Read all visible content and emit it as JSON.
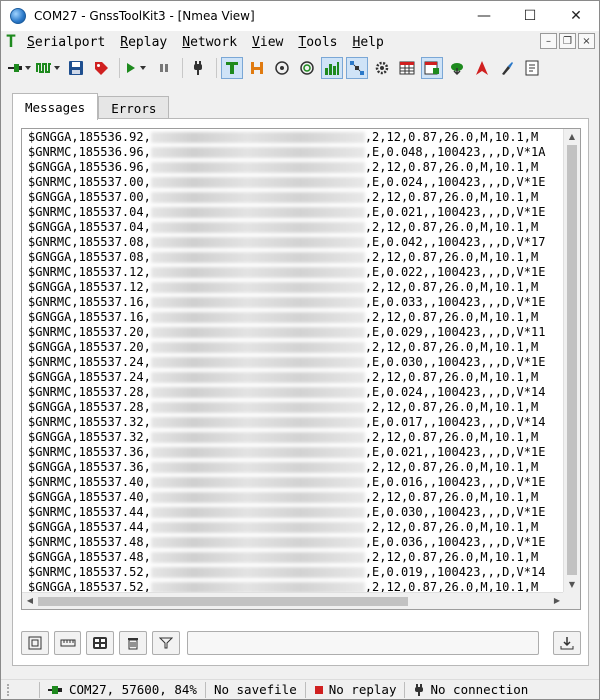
{
  "window": {
    "title": "COM27 - GnssToolKit3 - [Nmea View]",
    "controls": [
      "—",
      "☐",
      "✕"
    ]
  },
  "menu": {
    "logo": "T",
    "items": [
      {
        "label": "Serialport",
        "accel": "S"
      },
      {
        "label": "Replay",
        "accel": "R"
      },
      {
        "label": "Network",
        "accel": "N"
      },
      {
        "label": "View",
        "accel": "V"
      },
      {
        "label": "Tools",
        "accel": "T"
      },
      {
        "label": "Help",
        "accel": "H"
      }
    ]
  },
  "tabs": [
    {
      "label": "Messages",
      "active": true
    },
    {
      "label": "Errors",
      "active": false
    }
  ],
  "messages": [
    {
      "prefix": "$GNGGA,185536.92,",
      "suffix": ",2,12,0.87,26.0,M,10.1,M"
    },
    {
      "prefix": "$GNRMC,185536.96,",
      "suffix": ",E,0.048,,100423,,,D,V*1A"
    },
    {
      "prefix": "$GNGGA,185536.96,",
      "suffix": ",2,12,0.87,26.0,M,10.1,M"
    },
    {
      "prefix": "$GNRMC,185537.00,",
      "suffix": ",E,0.024,,100423,,,D,V*1E"
    },
    {
      "prefix": "$GNGGA,185537.00,",
      "suffix": ",2,12,0.87,26.0,M,10.1,M"
    },
    {
      "prefix": "$GNRMC,185537.04,",
      "suffix": ",E,0.021,,100423,,,D,V*1E"
    },
    {
      "prefix": "$GNGGA,185537.04,",
      "suffix": ",2,12,0.87,26.0,M,10.1,M"
    },
    {
      "prefix": "$GNRMC,185537.08,",
      "suffix": ",E,0.042,,100423,,,D,V*17"
    },
    {
      "prefix": "$GNGGA,185537.08,",
      "suffix": ",2,12,0.87,26.0,M,10.1,M"
    },
    {
      "prefix": "$GNRMC,185537.12,",
      "suffix": ",E,0.022,,100423,,,D,V*1E"
    },
    {
      "prefix": "$GNGGA,185537.12,",
      "suffix": ",2,12,0.87,26.0,M,10.1,M"
    },
    {
      "prefix": "$GNRMC,185537.16,",
      "suffix": ",E,0.033,,100423,,,D,V*1E"
    },
    {
      "prefix": "$GNGGA,185537.16,",
      "suffix": ",2,12,0.87,26.0,M,10.1,M"
    },
    {
      "prefix": "$GNRMC,185537.20,",
      "suffix": ",E,0.029,,100423,,,D,V*11"
    },
    {
      "prefix": "$GNGGA,185537.20,",
      "suffix": ",2,12,0.87,26.0,M,10.1,M"
    },
    {
      "prefix": "$GNRMC,185537.24,",
      "suffix": ",E,0.030,,100423,,,D,V*1E"
    },
    {
      "prefix": "$GNGGA,185537.24,",
      "suffix": ",2,12,0.87,26.0,M,10.1,M"
    },
    {
      "prefix": "$GNRMC,185537.28,",
      "suffix": ",E,0.024,,100423,,,D,V*14"
    },
    {
      "prefix": "$GNGGA,185537.28,",
      "suffix": ",2,12,0.87,26.0,M,10.1,M"
    },
    {
      "prefix": "$GNRMC,185537.32,",
      "suffix": ",E,0.017,,100423,,,D,V*14"
    },
    {
      "prefix": "$GNGGA,185537.32,",
      "suffix": ",2,12,0.87,26.0,M,10.1,M"
    },
    {
      "prefix": "$GNRMC,185537.36,",
      "suffix": ",E,0.021,,100423,,,D,V*1E"
    },
    {
      "prefix": "$GNGGA,185537.36,",
      "suffix": ",2,12,0.87,26.0,M,10.1,M"
    },
    {
      "prefix": "$GNRMC,185537.40,",
      "suffix": ",E,0.016,,100423,,,D,V*1E"
    },
    {
      "prefix": "$GNGGA,185537.40,",
      "suffix": ",2,12,0.87,26.0,M,10.1,M"
    },
    {
      "prefix": "$GNRMC,185537.44,",
      "suffix": ",E,0.030,,100423,,,D,V*1E"
    },
    {
      "prefix": "$GNGGA,185537.44,",
      "suffix": ",2,12,0.87,26.0,M,10.1,M"
    },
    {
      "prefix": "$GNRMC,185537.48,",
      "suffix": ",E,0.036,,100423,,,D,V*1E"
    },
    {
      "prefix": "$GNGGA,185537.48,",
      "suffix": ",2,12,0.87,26.0,M,10.1,M"
    },
    {
      "prefix": "$GNRMC,185537.52,",
      "suffix": ",E,0.019,,100423,,,D,V*14"
    },
    {
      "prefix": "$GNGGA,185537.52,",
      "suffix": ",2,12,0.87,26.0,M,10.1,M"
    }
  ],
  "filter": {
    "value": ""
  },
  "status": {
    "port": "COM27, 57600, 84%",
    "save": "No savefile",
    "replay": "No replay",
    "connection": "No connection"
  },
  "colors": {
    "accent": "#2a78c8",
    "logo_green": "#1e8a1e",
    "record_red": "#d02020"
  }
}
